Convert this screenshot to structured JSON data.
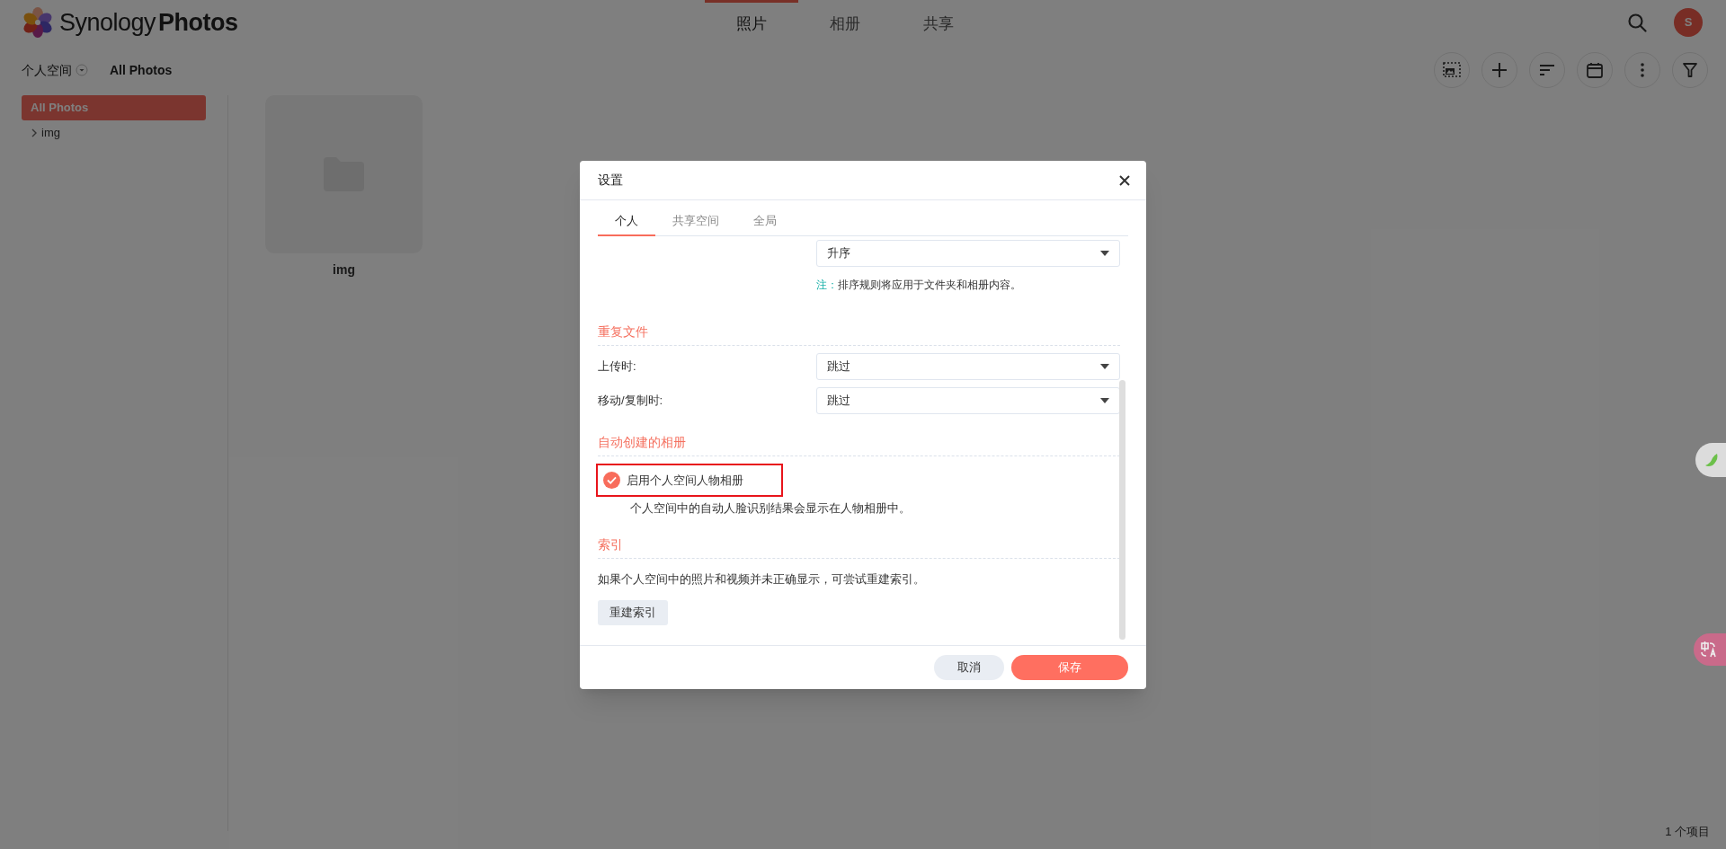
{
  "app": {
    "logo_light": "Synology",
    "logo_bold": "Photos"
  },
  "nav_tabs": [
    {
      "label": "照片",
      "selected": true
    },
    {
      "label": "相册",
      "selected": false
    },
    {
      "label": "共享",
      "selected": false
    }
  ],
  "avatar": {
    "initial": "S"
  },
  "breadcrumb": {
    "space": "个人空间",
    "current": "All Photos"
  },
  "sidebar": {
    "items": [
      {
        "label": "All Photos",
        "kind": "root",
        "selected": true
      },
      {
        "label": "img",
        "kind": "folder",
        "selected": false
      }
    ]
  },
  "items": [
    {
      "name": "img",
      "kind": "folder"
    }
  ],
  "status_bar": "1 个项目",
  "dialog": {
    "title": "设置",
    "tabs": [
      {
        "label": "个人",
        "selected": true
      },
      {
        "label": "共享空间",
        "selected": false
      },
      {
        "label": "全局",
        "selected": false
      }
    ],
    "sections": [
      {
        "kind": "partial",
        "select": "升序",
        "note_label": "注：",
        "note": "排序规则将应用于文件夹和相册内容。"
      },
      {
        "kind": "selects",
        "heading": "重复文件",
        "rows": [
          {
            "label": "上传时:",
            "value": "跳过"
          },
          {
            "label": "移动/复制时:",
            "value": "跳过"
          }
        ]
      },
      {
        "kind": "checkbox",
        "heading": "自动创建的相册",
        "label": "启用个人空间人物相册",
        "checked": true,
        "highlighted": true,
        "description": "个人空间中的自动人脸识别结果会显示在人物相册中。"
      },
      {
        "kind": "action",
        "heading": "索引",
        "text": "如果个人空间中的照片和视频并未正确显示，可尝试重建索引。",
        "button": "重建索引"
      }
    ],
    "buttons": [
      {
        "label": "取消",
        "kind": "secondary"
      },
      {
        "label": "保存",
        "kind": "primary"
      }
    ]
  }
}
